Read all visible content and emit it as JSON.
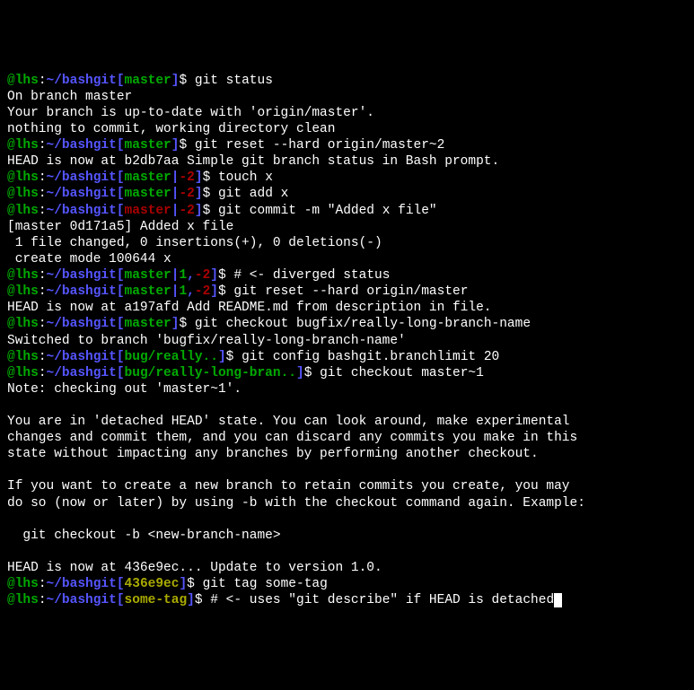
{
  "lines": [
    {
      "type": "prompt",
      "user": "",
      "host": "lhs",
      "path": "~/bashgit",
      "branch": "master",
      "branchStyle": "branch",
      "cmd": "git status"
    },
    {
      "type": "out",
      "text": "On branch master"
    },
    {
      "type": "out",
      "text": "Your branch is up-to-date with 'origin/master'."
    },
    {
      "type": "out",
      "text": "nothing to commit, working directory clean"
    },
    {
      "type": "prompt",
      "user": "",
      "host": "lhs",
      "path": "~/bashgit",
      "branch": "master",
      "branchStyle": "branch",
      "cmd": "git reset --hard origin/master~2"
    },
    {
      "type": "out",
      "text": "HEAD is now at b2db7aa Simple git branch status in Bash prompt."
    },
    {
      "type": "prompt",
      "user": "",
      "host": "lhs",
      "path": "~/bashgit",
      "branchParts": [
        {
          "t": "master",
          "s": "branch"
        },
        {
          "t": "|",
          "s": "branch-sep"
        },
        {
          "t": "-2",
          "s": "branch-behind"
        }
      ],
      "cmd": "touch x"
    },
    {
      "type": "prompt",
      "user": "",
      "host": "lhs",
      "path": "~/bashgit",
      "branchParts": [
        {
          "t": "master",
          "s": "branch"
        },
        {
          "t": "|",
          "s": "branch-sep"
        },
        {
          "t": "-2",
          "s": "branch-behind"
        }
      ],
      "cmd": "git add x"
    },
    {
      "type": "prompt",
      "user": "",
      "host": "lhs",
      "path": "~/bashgit",
      "branchParts": [
        {
          "t": "master",
          "s": "branch-behind"
        },
        {
          "t": "|",
          "s": "branch-sep"
        },
        {
          "t": "-2",
          "s": "branch-behind"
        }
      ],
      "cmd": "git commit -m \"Added x file\""
    },
    {
      "type": "out",
      "text": "[master 0d171a5] Added x file"
    },
    {
      "type": "out",
      "text": " 1 file changed, 0 insertions(+), 0 deletions(-)"
    },
    {
      "type": "out",
      "text": " create mode 100644 x"
    },
    {
      "type": "prompt",
      "user": "",
      "host": "lhs",
      "path": "~/bashgit",
      "branchParts": [
        {
          "t": "master",
          "s": "branch"
        },
        {
          "t": "|",
          "s": "branch-sep"
        },
        {
          "t": "1",
          "s": "branch-ahead"
        },
        {
          "t": ",",
          "s": "branch-sep"
        },
        {
          "t": "-2",
          "s": "branch-behind"
        }
      ],
      "cmd": "# <- diverged status"
    },
    {
      "type": "prompt",
      "user": "",
      "host": "lhs",
      "path": "~/bashgit",
      "branchParts": [
        {
          "t": "master",
          "s": "branch"
        },
        {
          "t": "|",
          "s": "branch-sep"
        },
        {
          "t": "1",
          "s": "branch-ahead"
        },
        {
          "t": ",",
          "s": "branch-sep"
        },
        {
          "t": "-2",
          "s": "branch-behind"
        }
      ],
      "cmd": "git reset --hard origin/master"
    },
    {
      "type": "out",
      "text": "HEAD is now at a197afd Add README.md from description in file."
    },
    {
      "type": "prompt",
      "user": "",
      "host": "lhs",
      "path": "~/bashgit",
      "branch": "master",
      "branchStyle": "branch",
      "cmd": "git checkout bugfix/really-long-branch-name"
    },
    {
      "type": "out",
      "text": "Switched to branch 'bugfix/really-long-branch-name'"
    },
    {
      "type": "prompt",
      "user": "",
      "host": "lhs",
      "path": "~/bashgit",
      "branch": "bug/really..",
      "branchStyle": "branch",
      "cmd": "git config bashgit.branchlimit 20"
    },
    {
      "type": "prompt",
      "user": "",
      "host": "lhs",
      "path": "~/bashgit",
      "branch": "bug/really-long-bran..",
      "branchStyle": "branch",
      "cmd": "git checkout master~1"
    },
    {
      "type": "out",
      "text": "Note: checking out 'master~1'."
    },
    {
      "type": "blank"
    },
    {
      "type": "out",
      "text": "You are in 'detached HEAD' state. You can look around, make experimental"
    },
    {
      "type": "out",
      "text": "changes and commit them, and you can discard any commits you make in this"
    },
    {
      "type": "out",
      "text": "state without impacting any branches by performing another checkout."
    },
    {
      "type": "blank"
    },
    {
      "type": "out",
      "text": "If you want to create a new branch to retain commits you create, you may"
    },
    {
      "type": "out",
      "text": "do so (now or later) by using -b with the checkout command again. Example:"
    },
    {
      "type": "blank"
    },
    {
      "type": "out",
      "text": "  git checkout -b <new-branch-name>"
    },
    {
      "type": "blank"
    },
    {
      "type": "out",
      "text": "HEAD is now at 436e9ec... Update to version 1.0."
    },
    {
      "type": "prompt",
      "user": "",
      "host": "lhs",
      "path": "~/bashgit",
      "branch": "436e9ec",
      "branchStyle": "branch-yellow",
      "cmd": "git tag some-tag"
    },
    {
      "type": "prompt",
      "user": "",
      "host": "lhs",
      "path": "~/bashgit",
      "branch": "some-tag",
      "branchStyle": "branch-yellow",
      "cmd": "# <- uses \"git describe\" if HEAD is detached",
      "cursor": true
    }
  ]
}
